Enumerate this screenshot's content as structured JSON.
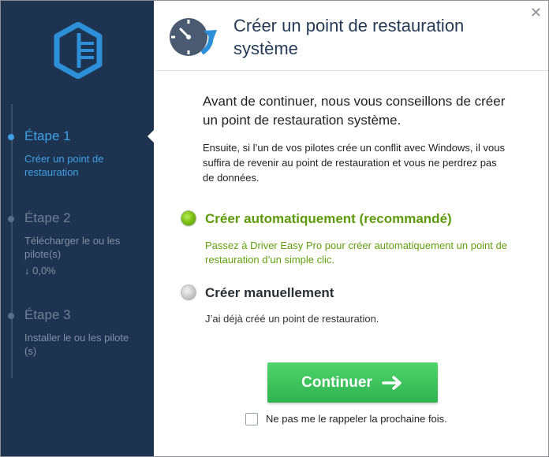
{
  "window": {
    "title_line1": "Créer un point de restauration",
    "title_line2": "système",
    "close_glyph": "✕"
  },
  "sidebar": {
    "steps": [
      {
        "title": "Étape 1",
        "desc_line1": "Créer un point de",
        "desc_line2": "restauration",
        "active": true
      },
      {
        "title": "Étape 2",
        "desc_line1": "Télécharger le ou les",
        "desc_line2": "pilote(s)",
        "extra": "↓ 0,0%",
        "active": false
      },
      {
        "title": "Étape 3",
        "desc_line1": "Installer le ou les pilote",
        "desc_line2": "(s)",
        "active": false
      }
    ]
  },
  "main": {
    "intro_line1": "Avant de continuer, nous vous conseillons de créer",
    "intro_line2": "un point de restauration système.",
    "info_line1": "Ensuite, si l’un de vos pilotes crée un conflit avec Windows, il vous",
    "info_line2": "suffira de revenir au point de restauration et vous ne perdrez pas",
    "info_line3": "de données.",
    "options": [
      {
        "label": "Créer automatiquement (recommandé)",
        "desc_line1": "Passez à Driver Easy Pro pour créer automatiquement un point de",
        "desc_line2": "restauration d’un simple clic.",
        "selected": true
      },
      {
        "label": "Créer manuellement",
        "desc": "J’ai déjà créé un point de restauration.",
        "selected": false
      }
    ],
    "continue_label": "Continuer",
    "dont_remind_label": "Ne pas me le rappeler la prochaine fois.",
    "dont_remind_checked": false
  },
  "icons": {
    "logo": "driver-easy-logo-icon",
    "header": "restore-clock-icon",
    "close": "close-icon",
    "continue_arrow": "arrow-right-icon"
  },
  "colors": {
    "sidebar_bg": "#1e3350",
    "active_step": "#3ea0e6",
    "recommended_green": "#5c9a0a",
    "button_green": "#3cc25b",
    "title_text": "#253a55"
  }
}
